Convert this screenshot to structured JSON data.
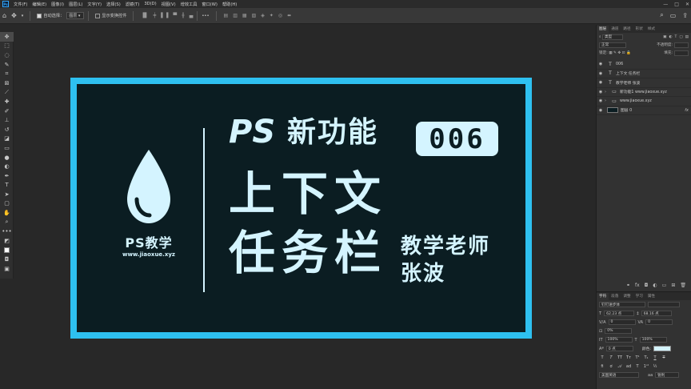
{
  "app": {
    "logo_text": "Ps"
  },
  "menu": [
    "文件(F)",
    "编辑(E)",
    "图像(I)",
    "图层(L)",
    "文字(Y)",
    "选择(S)",
    "滤镜(T)",
    "3D(D)",
    "视图(V)",
    "增效工具",
    "窗口(W)",
    "帮助(H)"
  ],
  "window_controls": {
    "minimize": "—",
    "maximize": "□",
    "close": "✕"
  },
  "options": {
    "auto_select_label": "自动选择：",
    "auto_select_value": "图层",
    "transform_label": "显示变换控件",
    "more": "•••"
  },
  "canvas": {
    "brand": "PS教学",
    "url": "www.jiaoxue.xyz",
    "title_ps": "PS",
    "title_cn": "新功能",
    "number": "006",
    "topic_line1": "上下文",
    "topic_line2": "任务栏",
    "teacher_role": "教学老师",
    "teacher_name": "张波",
    "colors": {
      "frame": "#2ec0f0",
      "background": "#0b1d22",
      "text": "#d4f4ff"
    }
  },
  "layers_panel": {
    "tabs": [
      "图层",
      "通道",
      "路径",
      "形状",
      "样式"
    ],
    "filter_label": "类型",
    "mode_label": "正常",
    "opacity_label": "不透明度:",
    "lock_label": "锁定:",
    "fill_label": "填充:",
    "layers": [
      {
        "kind": "T",
        "name": "006"
      },
      {
        "kind": "T",
        "name": "上下文 任务栏"
      },
      {
        "kind": "T",
        "name": "教学老师 张波"
      },
      {
        "kind": "folder",
        "name": "新功能1 www.jiaoxue.xyz"
      },
      {
        "kind": "folder",
        "name": "www.jiaoxue.xyz"
      },
      {
        "kind": "image",
        "name": "图层 0",
        "fx": "fx"
      }
    ]
  },
  "char_panel": {
    "tabs": [
      "字符",
      "段落",
      "调整",
      "学习",
      "属性"
    ],
    "font_family": "钉钉进步体",
    "font_size": "62.23 点",
    "leading": "68.16 点",
    "kerning": "0",
    "tracking": "0",
    "scale_pct": "0%",
    "vscale": "100%",
    "hscale": "100%",
    "baseline": "0 点",
    "color_label": "颜色:",
    "language": "美国英语",
    "antialias": "锐利"
  }
}
